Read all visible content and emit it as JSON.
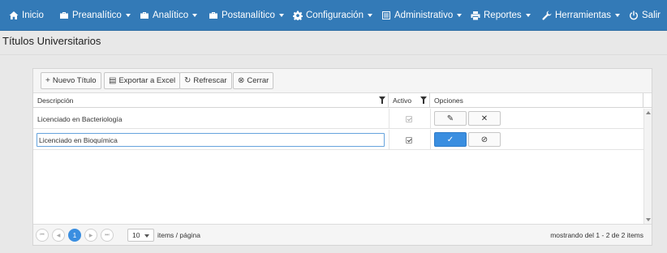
{
  "nav": {
    "items": [
      {
        "label": "Inicio",
        "icon": "home-icon",
        "dropdown": false
      },
      {
        "label": "Preanalítico",
        "icon": "briefcase-icon",
        "dropdown": true
      },
      {
        "label": "Analítico",
        "icon": "briefcase-icon",
        "dropdown": true
      },
      {
        "label": "Postanalítico",
        "icon": "briefcase-icon",
        "dropdown": true
      },
      {
        "label": "Configuración",
        "icon": "gear-icon",
        "dropdown": true
      },
      {
        "label": "Administrativo",
        "icon": "list-icon",
        "dropdown": true
      },
      {
        "label": "Reportes",
        "icon": "print-icon",
        "dropdown": true
      },
      {
        "label": "Herramientas",
        "icon": "wrench-icon",
        "dropdown": true
      },
      {
        "label": "Salir",
        "icon": "power-icon",
        "dropdown": false
      }
    ],
    "color": "#337ab7"
  },
  "page": {
    "title": "Títulos Universitarios"
  },
  "toolbar": {
    "new": "Nuevo Título",
    "export": "Exportar a Excel",
    "refresh": "Refrescar",
    "close": "Cerrar"
  },
  "grid": {
    "columns": [
      "Descripción",
      "Activo",
      "Opciones"
    ],
    "rows": [
      {
        "description": "Licenciado en Bacteriología",
        "active": true,
        "mode": "view"
      },
      {
        "description": "Licenciado en Bioquímica",
        "active": true,
        "mode": "edit"
      }
    ]
  },
  "pager": {
    "first_icon": "first-page-icon",
    "prev_icon": "prev-page-icon",
    "current_page": "1",
    "next_icon": "next-page-icon",
    "last_icon": "last-page-icon",
    "page_size": "10",
    "page_size_label": "items / página",
    "info": "mostrando del 1 - 2 de 2 items"
  },
  "accent": "#3a8ee0"
}
